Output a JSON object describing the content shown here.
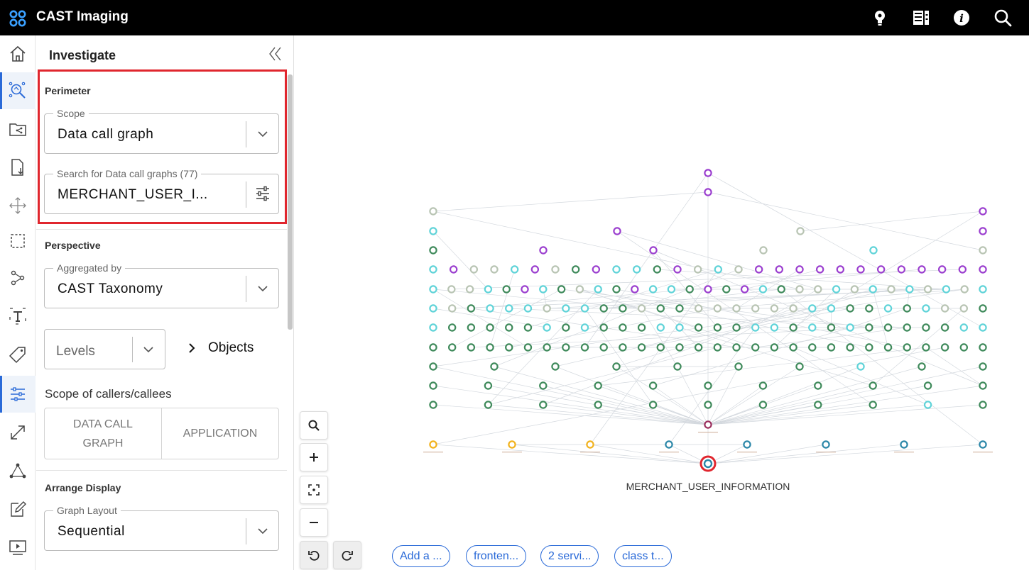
{
  "app": {
    "title": "CAST Imaging"
  },
  "topbar": {
    "icons": [
      "lightbulb-icon",
      "report-icon",
      "info-icon",
      "search-icon"
    ]
  },
  "rail": {
    "items": [
      "home-icon",
      "investigate-icon",
      "folder-share-icon",
      "file-download-icon",
      "move-icon",
      "selection-icon",
      "path-icon",
      "text-icon",
      "tag-icon",
      "filter-sliders-icon",
      "expand-icon",
      "network-icon",
      "edit-icon",
      "presentation-icon"
    ],
    "active": [
      "investigate-icon",
      "filter-sliders-icon"
    ]
  },
  "panel": {
    "title": "Investigate",
    "perimeter": {
      "title": "Perimeter",
      "scope_label": "Scope",
      "scope_value": "Data call graph",
      "search_label": "Search for Data call graphs (77)",
      "search_value": "MERCHANT_USER_I..."
    },
    "perspective": {
      "title": "Perspective",
      "aggregated_label": "Aggregated by",
      "aggregated_value": "CAST Taxonomy",
      "levels_placeholder": "Levels",
      "objects_label": "Objects",
      "scope_callers_title": "Scope of callers/callees",
      "scope_buttons": [
        "DATA CALL GRAPH",
        "APPLICATION"
      ],
      "scope_btn_1_line1": "DATA CALL",
      "scope_btn_1_line2": "GRAPH",
      "scope_btn_2": "APPLICATION"
    },
    "arrange": {
      "title": "Arrange Display",
      "layout_label": "Graph Layout",
      "layout_value": "Sequential"
    }
  },
  "graph": {
    "focus_node_label": "MERCHANT_USER_INFORMATION",
    "colors": {
      "green": "#3f8a5b",
      "cyan": "#5fd3d8",
      "purple": "#9b3fcf",
      "grey": "#b8c4b3",
      "orange": "#f2b21c",
      "blue": "#2b87a8",
      "maroon": "#9b2f5e",
      "focus_ring": "#e0262e"
    }
  },
  "controls": {
    "buttons": [
      "search-icon",
      "zoom-in-icon",
      "fit-screen-icon",
      "zoom-out-icon",
      "undo-icon",
      "redo-icon"
    ]
  },
  "chips": [
    "Add a ...",
    "fronten...",
    "2 servi...",
    "class t..."
  ]
}
